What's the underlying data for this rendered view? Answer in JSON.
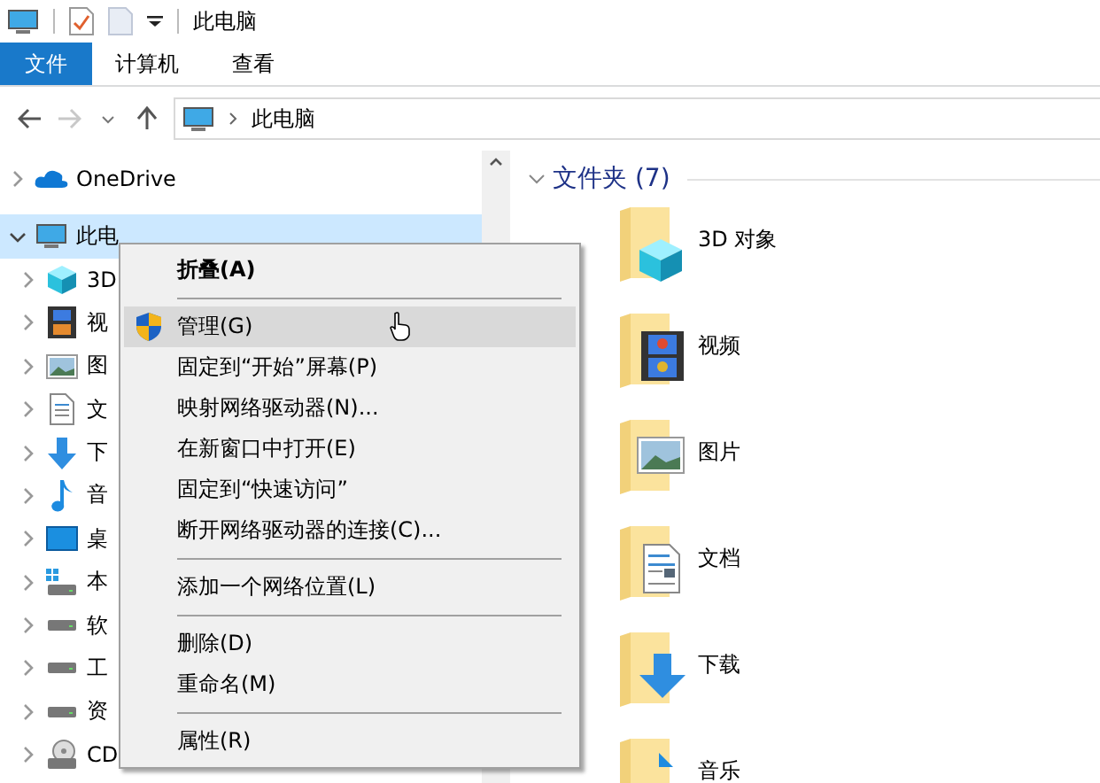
{
  "window": {
    "title": "此电脑"
  },
  "ribbon_tabs": [
    {
      "label": "文件",
      "selected": true
    },
    {
      "label": "计算机",
      "selected": false
    },
    {
      "label": "查看",
      "selected": false
    }
  ],
  "address_bar": {
    "path": "此电脑"
  },
  "sidebar": {
    "items": [
      {
        "label": "OneDrive",
        "kind": "onedrive",
        "expanded": false,
        "selected": false
      },
      {
        "label": "此电",
        "kind": "pc",
        "expanded": true,
        "selected": true
      },
      {
        "label": "3D",
        "kind": "cube",
        "expanded": false,
        "selected": false
      },
      {
        "label": "视",
        "kind": "video",
        "expanded": false,
        "selected": false
      },
      {
        "label": "图",
        "kind": "picture",
        "expanded": false,
        "selected": false
      },
      {
        "label": "文",
        "kind": "document",
        "expanded": false,
        "selected": false
      },
      {
        "label": "下",
        "kind": "download",
        "expanded": false,
        "selected": false
      },
      {
        "label": "音",
        "kind": "music",
        "expanded": false,
        "selected": false
      },
      {
        "label": "桌",
        "kind": "desktop",
        "expanded": false,
        "selected": false
      },
      {
        "label": "本",
        "kind": "windrive",
        "expanded": false,
        "selected": false
      },
      {
        "label": "软",
        "kind": "drive",
        "expanded": false,
        "selected": false
      },
      {
        "label": "工",
        "kind": "drive",
        "expanded": false,
        "selected": false
      },
      {
        "label": "资",
        "kind": "drive",
        "expanded": false,
        "selected": false
      },
      {
        "label": "CD",
        "kind": "cd",
        "expanded": false,
        "selected": false
      }
    ]
  },
  "content": {
    "group_title": "文件夹 (7)",
    "expanded": true,
    "folders": [
      {
        "label": "3D 对象",
        "kind": "cube"
      },
      {
        "label": "视频",
        "kind": "video"
      },
      {
        "label": "图片",
        "kind": "picture"
      },
      {
        "label": "文档",
        "kind": "document"
      },
      {
        "label": "下载",
        "kind": "download"
      },
      {
        "label": "音乐",
        "kind": "music"
      }
    ]
  },
  "context_menu": {
    "items": [
      {
        "kind": "item",
        "label": "折叠(A)",
        "default": true,
        "selected": false
      },
      {
        "kind": "separator"
      },
      {
        "kind": "shield-item",
        "label": "管理(G)",
        "default": false,
        "selected": true
      },
      {
        "kind": "item",
        "label": "固定到“开始”屏幕(P)",
        "default": false,
        "selected": false
      },
      {
        "kind": "item",
        "label": "映射网络驱动器(N)...",
        "default": false,
        "selected": false
      },
      {
        "kind": "item",
        "label": "在新窗口中打开(E)",
        "default": false,
        "selected": false
      },
      {
        "kind": "item",
        "label": "固定到“快速访问”",
        "default": false,
        "selected": false
      },
      {
        "kind": "item",
        "label": "断开网络驱动器的连接(C)...",
        "default": false,
        "selected": false
      },
      {
        "kind": "separator"
      },
      {
        "kind": "item",
        "label": "添加一个网络位置(L)",
        "default": false,
        "selected": false
      },
      {
        "kind": "separator"
      },
      {
        "kind": "item",
        "label": "删除(D)",
        "default": false,
        "selected": false
      },
      {
        "kind": "item",
        "label": "重命名(M)",
        "default": false,
        "selected": false
      },
      {
        "kind": "separator"
      },
      {
        "kind": "item",
        "label": "属性(R)",
        "default": false,
        "selected": false
      }
    ]
  }
}
